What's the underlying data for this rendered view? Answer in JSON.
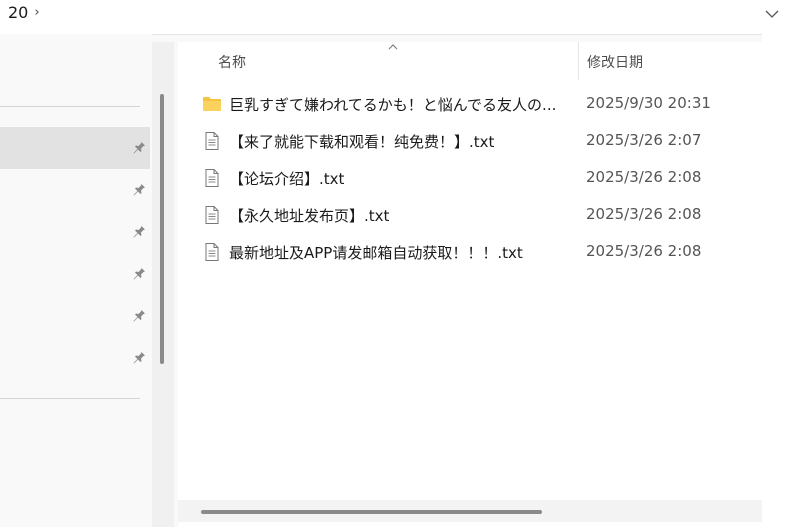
{
  "address_bar": {
    "path_segment": "20",
    "separator": "›"
  },
  "columns": {
    "name": "名称",
    "date_modified": "修改日期"
  },
  "files": [
    {
      "type": "folder",
      "icon": "folder-icon",
      "name": "巨乳すぎて嫌われてるかも！と悩んでる友人の...",
      "date": "2025/9/30 20:31"
    },
    {
      "type": "txt",
      "icon": "text-file-icon",
      "name": "【来了就能下载和观看！纯免费！】.txt",
      "date": "2025/3/26 2:07"
    },
    {
      "type": "txt",
      "icon": "text-file-icon",
      "name": "【论坛介绍】.txt",
      "date": "2025/3/26 2:08"
    },
    {
      "type": "txt",
      "icon": "text-file-icon",
      "name": "【永久地址发布页】.txt",
      "date": "2025/3/26 2:08"
    },
    {
      "type": "txt",
      "icon": "text-file-icon",
      "name": "最新地址及APP请发邮箱自动获取！！！.txt",
      "date": "2025/3/26 2:08"
    }
  ],
  "colors": {
    "folder": "#f6c342",
    "selection": "#e2e2e2",
    "scroll_thumb": "#8a8a8a"
  }
}
